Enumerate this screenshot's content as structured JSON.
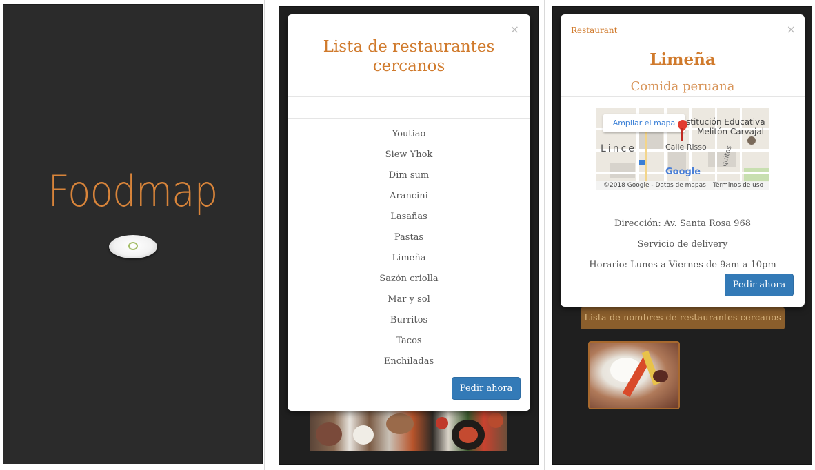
{
  "splash": {
    "brand": "Foodmap",
    "brand_color": "#d8843a",
    "logo_icon": "food-logo-icon"
  },
  "list_modal": {
    "close_label": "×",
    "title": "Lista de restaurantes cercanos",
    "restaurants": [
      "Youtiao",
      "Siew Yhok",
      "Dim sum",
      "Arancini",
      "Lasañas",
      "Pastas",
      "Limeña",
      "Sazón criolla",
      "Mar y sol",
      "Burritos",
      "Tacos",
      "Enchiladas"
    ],
    "order_button": "Pedir ahora"
  },
  "detail_modal": {
    "close_label": "×",
    "header_label": "Restaurant",
    "name": "Limeña",
    "cuisine": "Comida peruana",
    "map": {
      "enlarge_button": "Ampliar el mapa",
      "place_title_1": "stitución Educativa",
      "place_title_2": "Melitón Carvajal",
      "district": "Lince",
      "street": "Calle Risso",
      "street_vertical": "quitos",
      "logo": "Google",
      "copyright": "©2018 Google - Datos de mapas",
      "terms": "Términos de uso"
    },
    "address": "Dirección: Av. Santa Rosa 968",
    "delivery": "Servicio de delivery",
    "hours": "Horario: Lunes a Viernes de 9am a 10pm",
    "order_button": "Pedir ahora"
  },
  "background_screen": {
    "list_button": "Lista de nombres de restaurantes cercanos"
  },
  "colors": {
    "accent": "#d07a2c",
    "primary_button": "#337ab7",
    "dark_bg": "#1f1f1f"
  }
}
